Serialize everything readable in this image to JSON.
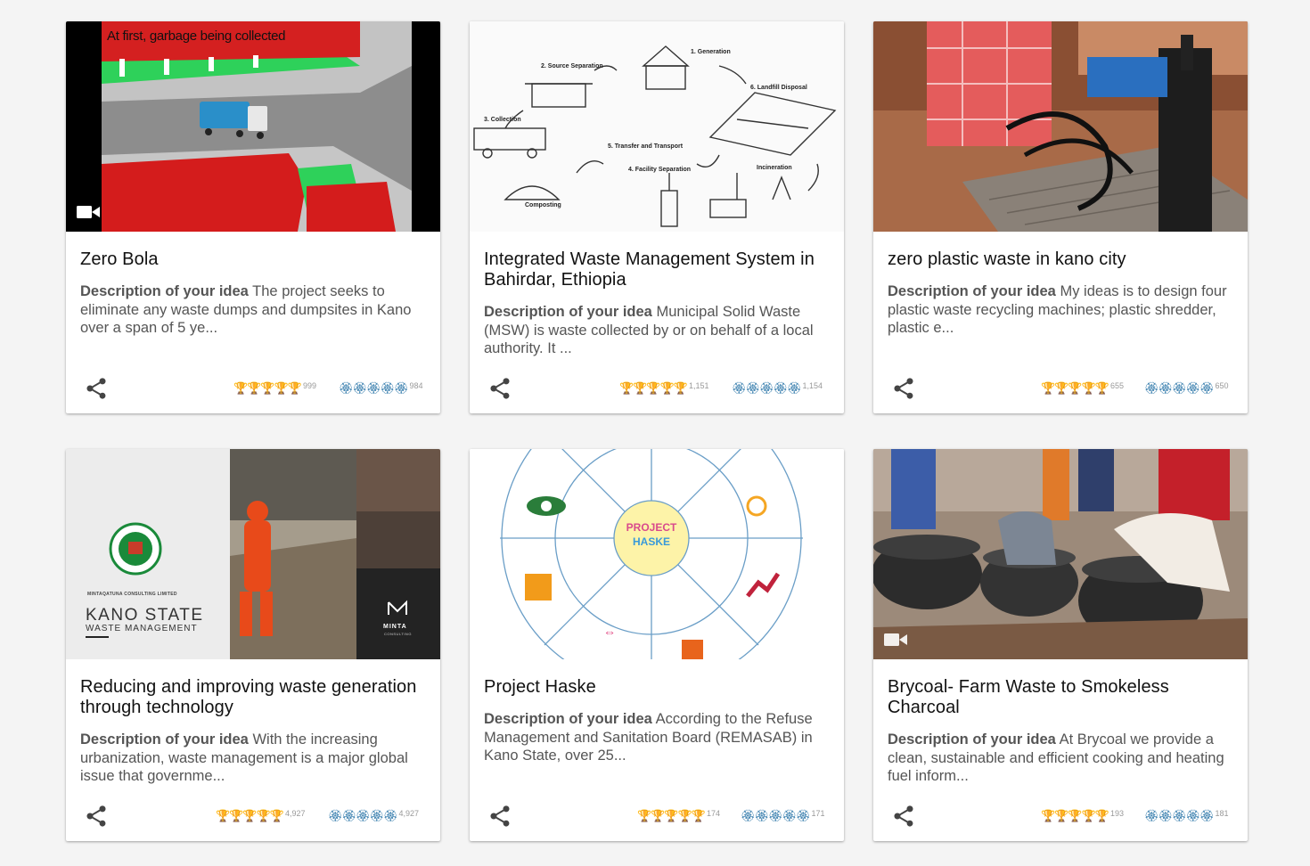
{
  "cards": [
    {
      "media_caption": "At first, garbage being collected",
      "media_icon": "video-camera-icon",
      "title": "Zero Bola",
      "desc_label": "Description of your idea",
      "desc_text": "The project seeks to eliminate any waste dumps and dumpsites in Kano over a span of 5 ye...",
      "trophies": "🏆🏆🏆🏆🏆",
      "trophy_count": "999",
      "medals": "🏵🏵🏵🏵🏵",
      "medal_count": "984"
    },
    {
      "diagram_labels": [
        "1. Generation",
        "2. Source Separation",
        "3. Collection",
        "4. Facility Separation",
        "5. Transfer and Transport",
        "6. Landfill Disposal",
        "Incineration",
        "Composting"
      ],
      "title": "Integrated Waste Management System in Bahirdar, Ethiopia",
      "desc_label": "Description of your idea",
      "desc_text": "Municipal Solid Waste (MSW) is waste collected by or on behalf of a local authority. It ...",
      "trophies": "🏆🏆🏆🏆🏆",
      "trophy_count": "1,151",
      "medals": "🏵🏵🏵🏵🏵",
      "medal_count": "1,154"
    },
    {
      "title": "zero plastic waste in kano city",
      "desc_label": "Description of your idea",
      "desc_text": "My ideas is to design four plastic waste recycling machines; plastic shredder, plastic e...",
      "trophies": "🏆🏆🏆🏆🏆",
      "trophy_count": "655",
      "medals": "🏵🏵🏵🏵🏵",
      "medal_count": "650"
    },
    {
      "brand_small": "MINTAQATUNA CONSULTING LIMITED",
      "brand_main": "KANO STATE",
      "brand_sub": "WASTE MANAGEMENT",
      "logo_text": "MINTA",
      "logo_sub": "CONSULTING",
      "title": "Reducing and improving waste generation through technology",
      "desc_label": "Description of your idea",
      "desc_text": "With the increasing urbanization, waste management is a major global issue that governme...",
      "trophies": "🏆🏆🏆🏆🏆",
      "trophy_count": "4,927",
      "medals": "🏵🏵🏵🏵🏵",
      "medal_count": "4,927"
    },
    {
      "wheel_center_line1": "PROJECT",
      "wheel_center_line2": "HASKE",
      "title": "Project Haske",
      "desc_label": "Description of your idea",
      "desc_text": "According to the Refuse Management and Sanitation Board (REMASAB) in Kano State, over 25...",
      "trophies": "🏆🏆🏆🏆🏆",
      "trophy_count": "174",
      "medals": "🏵🏵🏵🏵🏵",
      "medal_count": "171"
    },
    {
      "media_icon": "video-camera-icon",
      "title": "Brycoal- Farm Waste to Smokeless Charcoal",
      "desc_label": "Description of your idea",
      "desc_text": "At Brycoal we provide a clean, sustainable and efficient cooking and heating fuel inform...",
      "trophies": "🏆🏆🏆🏆🏆",
      "trophy_count": "193",
      "medals": "🏵🏵🏵🏵🏵",
      "medal_count": "181"
    }
  ]
}
